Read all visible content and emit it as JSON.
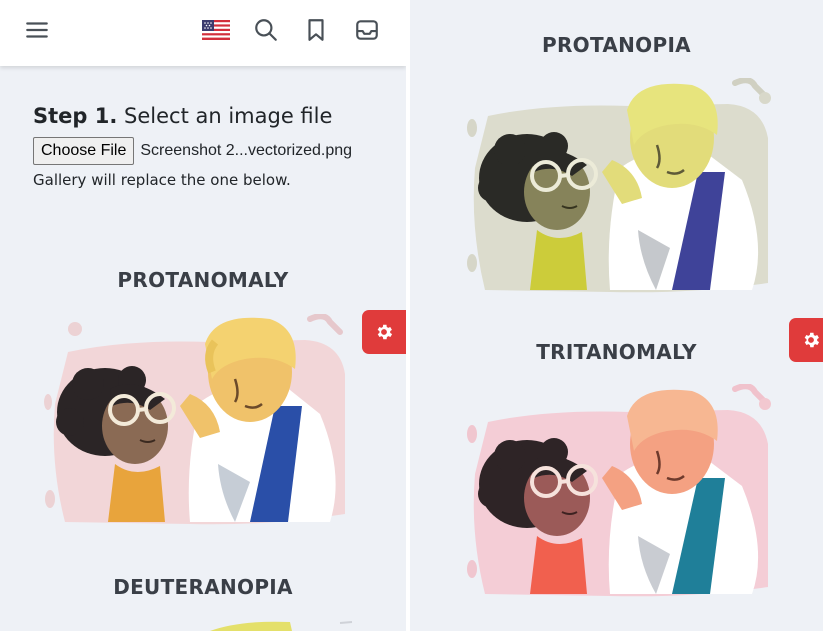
{
  "navbar": {
    "menu_icon": "hamburger-menu-icon",
    "flag_icon": "us-flag-icon",
    "search_icon": "search-icon",
    "bookmark_icon": "bookmark-icon",
    "inbox_icon": "inbox-icon"
  },
  "step": {
    "number": "Step 1.",
    "text": " Select an image file",
    "choose_button": "Choose File",
    "file_name": "Screenshot 2...vectorized.png",
    "note": "Gallery will replace the one below."
  },
  "left_gallery": [
    {
      "title": "PROTANOMALY"
    },
    {
      "title": "DEUTERANOPIA"
    }
  ],
  "right_gallery": [
    {
      "title": "PROTANOPIA"
    },
    {
      "title": "TRITANOMALY"
    }
  ],
  "settings_icon": "gear-icon",
  "colors": {
    "panel_bg": "#eef1f6",
    "accent_red": "#e03b3b",
    "heading_text": "#3a3f47"
  }
}
